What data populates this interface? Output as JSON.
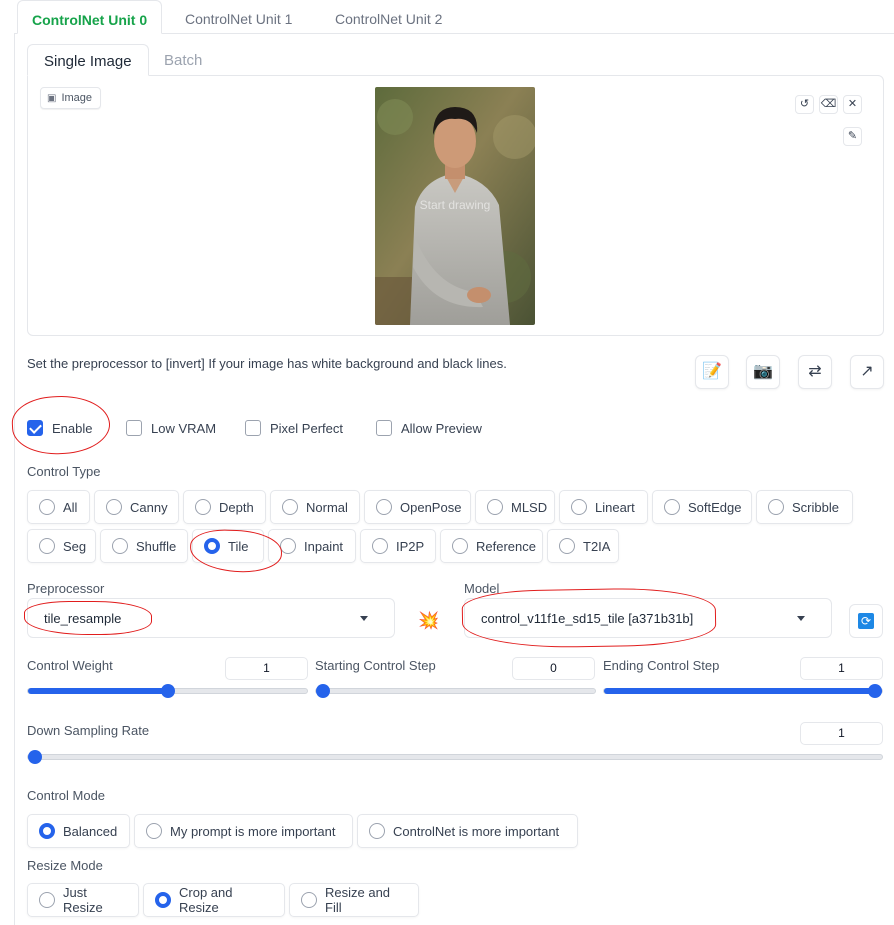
{
  "unit_tabs": [
    "ControlNet Unit 0",
    "ControlNet Unit 1",
    "ControlNet Unit 2"
  ],
  "image_tabs": [
    "Single Image",
    "Batch"
  ],
  "image_panel": {
    "label": "Image",
    "canvas_text": "Start drawing"
  },
  "hint": "Set the preprocessor to [invert] If your image has white background and black lines.",
  "options": {
    "enable": {
      "label": "Enable",
      "checked": true
    },
    "low_vram": {
      "label": "Low VRAM",
      "checked": false
    },
    "pixel_perfect": {
      "label": "Pixel Perfect",
      "checked": false
    },
    "allow_preview": {
      "label": "Allow Preview",
      "checked": false
    }
  },
  "control_type": {
    "label": "Control Type",
    "items": [
      "All",
      "Canny",
      "Depth",
      "Normal",
      "OpenPose",
      "MLSD",
      "Lineart",
      "SoftEdge",
      "Scribble",
      "Seg",
      "Shuffle",
      "Tile",
      "Inpaint",
      "IP2P",
      "Reference",
      "T2IA"
    ],
    "selected": "Tile"
  },
  "preprocessor": {
    "label": "Preprocessor",
    "value": "tile_resample"
  },
  "model": {
    "label": "Model",
    "value": "control_v11f1e_sd15_tile [a371b31b]"
  },
  "sliders": {
    "control_weight": {
      "label": "Control Weight",
      "value": "1",
      "fraction": 0.5
    },
    "starting_step": {
      "label": "Starting Control Step",
      "value": "0",
      "fraction": 0.0
    },
    "ending_step": {
      "label": "Ending Control Step",
      "value": "1",
      "fraction": 1.0
    },
    "down_sampling": {
      "label": "Down Sampling Rate",
      "value": "1",
      "fraction": 0.0
    }
  },
  "control_mode": {
    "label": "Control Mode",
    "items": [
      "Balanced",
      "My prompt is more important",
      "ControlNet is more important"
    ],
    "selected": "Balanced"
  },
  "resize_mode": {
    "label": "Resize Mode",
    "items": [
      "Just Resize",
      "Crop and Resize",
      "Resize and Fill"
    ],
    "selected": "Crop and Resize"
  },
  "colors": {
    "accent": "#2563eb",
    "active_tab": "#16a34a",
    "annotation": "#e11d1d"
  },
  "icons": [
    "image-icon",
    "undo-icon",
    "eraser-icon",
    "close-icon",
    "brush-icon",
    "notepad-icon",
    "camera-icon",
    "swap-icon",
    "send-icon",
    "explosion-icon",
    "refresh-icon"
  ]
}
